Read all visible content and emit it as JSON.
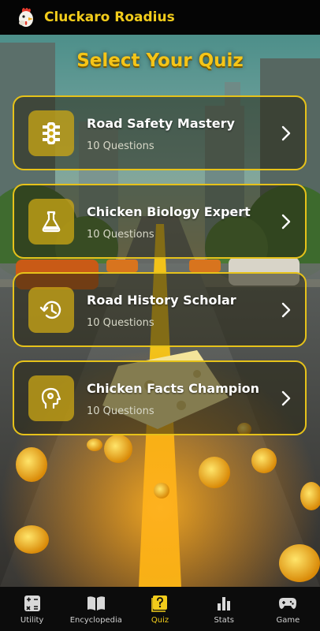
{
  "app": {
    "title": "Cluckaro Roadius",
    "logo_icon": "chicken-logo-icon"
  },
  "page": {
    "title": "Select Your Quiz"
  },
  "colors": {
    "accent": "#f2cc1b",
    "card_border": "#e6c21a",
    "card_icon_bg": "#cda814"
  },
  "quizzes": [
    {
      "title": "Road Safety Mastery",
      "subtitle": "10 Questions",
      "icon": "traffic-light-icon"
    },
    {
      "title": "Chicken Biology Expert",
      "subtitle": "10 Questions",
      "icon": "flask-icon"
    },
    {
      "title": "Road History Scholar",
      "subtitle": "10 Questions",
      "icon": "history-icon"
    },
    {
      "title": "Chicken Facts Champion",
      "subtitle": "10 Questions",
      "icon": "head-gear-icon"
    }
  ],
  "nav": {
    "items": [
      {
        "label": "Utility",
        "icon": "calculator-icon",
        "active": false
      },
      {
        "label": "Encyclopedia",
        "icon": "open-book-icon",
        "active": false
      },
      {
        "label": "Quiz",
        "icon": "quiz-icon",
        "active": true
      },
      {
        "label": "Stats",
        "icon": "bar-chart-icon",
        "active": false
      },
      {
        "label": "Game",
        "icon": "gamepad-icon",
        "active": false
      }
    ]
  }
}
